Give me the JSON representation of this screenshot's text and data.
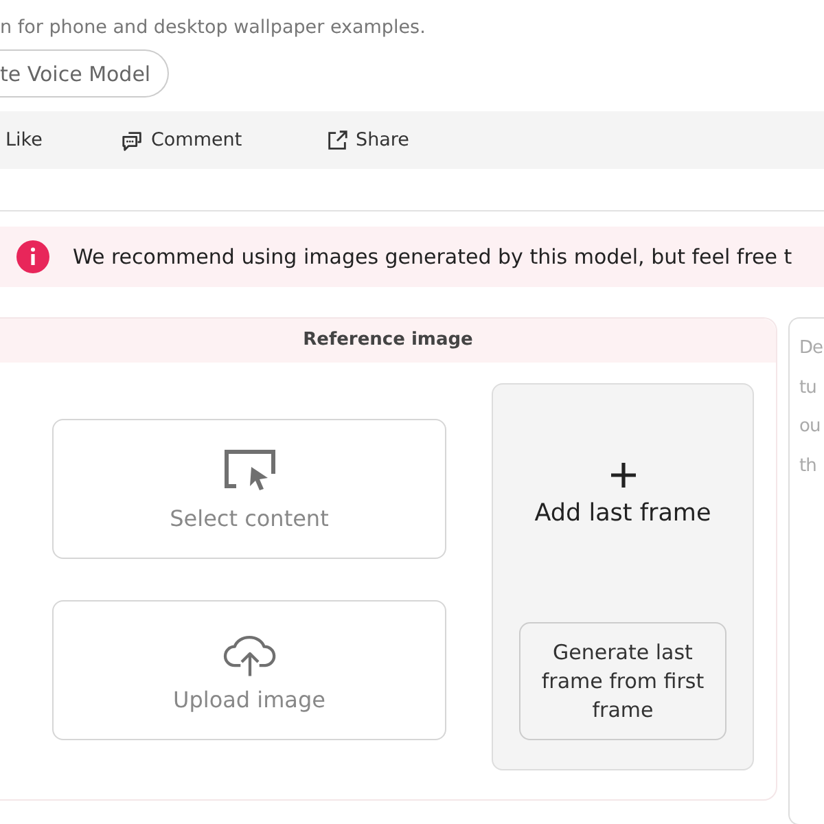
{
  "description": "n for phone and desktop wallpaper examples.",
  "voice_button": "te Voice Model",
  "actions": [
    {
      "kind": "like",
      "label": "Like"
    },
    {
      "kind": "comment",
      "label": "Comment"
    },
    {
      "kind": "share",
      "label": "Share"
    }
  ],
  "alert": "We recommend using images generated by this model, but feel free t",
  "reference_panel": {
    "title": "Reference image",
    "sources": [
      {
        "kind": "select",
        "label": "Select content"
      },
      {
        "kind": "upload",
        "label": "Upload image"
      }
    ],
    "last_frame": {
      "label": "Add last frame",
      "generate_button": "Generate last frame from first frame"
    }
  },
  "prompt_panel": {
    "placeholder_lines": [
      "De",
      "tu",
      "ou",
      "th"
    ]
  }
}
